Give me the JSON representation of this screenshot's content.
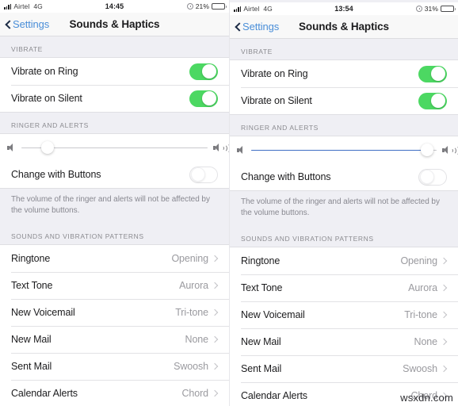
{
  "panels": [
    {
      "status": {
        "carrier": "Airtel",
        "network": "4G",
        "time": "14:45",
        "battery_percent": "21%",
        "battery_level": 0.21,
        "signal_icon": "signal-bars-icon",
        "alarm_icon": "alarm-clock-icon",
        "battery_icon": "battery-icon"
      },
      "nav": {
        "back_label": "Settings",
        "back_icon": "chevron-left-icon",
        "title": "Sounds & Haptics"
      },
      "vibrate": {
        "header": "VIBRATE",
        "rows": [
          {
            "label": "Vibrate on Ring",
            "state": "on"
          },
          {
            "label": "Vibrate on Silent",
            "state": "on"
          }
        ]
      },
      "ringer": {
        "header": "RINGER AND ALERTS",
        "slider": {
          "value": 14,
          "filled": false,
          "min_icon": "speaker-low-icon",
          "max_icon": "speaker-high-icon"
        },
        "change_with_buttons": {
          "label": "Change with Buttons",
          "state": "off"
        },
        "footer": "The volume of the ringer and alerts will not be affected by the volume buttons."
      },
      "sounds": {
        "header": "SOUNDS AND VIBRATION PATTERNS",
        "rows": [
          {
            "label": "Ringtone",
            "value": "Opening"
          },
          {
            "label": "Text Tone",
            "value": "Aurora"
          },
          {
            "label": "New Voicemail",
            "value": "Tri-tone"
          },
          {
            "label": "New Mail",
            "value": "None"
          },
          {
            "label": "Sent Mail",
            "value": "Swoosh"
          },
          {
            "label": "Calendar Alerts",
            "value": "Chord"
          }
        ]
      }
    },
    {
      "status": {
        "carrier": "Airtel",
        "network": "4G",
        "time": "13:54",
        "battery_percent": "31%",
        "battery_level": 0.31,
        "signal_icon": "signal-bars-icon",
        "alarm_icon": "alarm-clock-icon",
        "battery_icon": "battery-icon"
      },
      "nav": {
        "back_label": "Settings",
        "back_icon": "chevron-left-icon",
        "title": "Sounds & Haptics"
      },
      "vibrate": {
        "header": "VIBRATE",
        "rows": [
          {
            "label": "Vibrate on Ring",
            "state": "on"
          },
          {
            "label": "Vibrate on Silent",
            "state": "on"
          }
        ]
      },
      "ringer": {
        "header": "RINGER AND ALERTS",
        "slider": {
          "value": 95,
          "filled": true,
          "min_icon": "speaker-low-icon",
          "max_icon": "speaker-high-icon"
        },
        "change_with_buttons": {
          "label": "Change with Buttons",
          "state": "off"
        },
        "footer": "The volume of the ringer and alerts will not be affected by the volume buttons."
      },
      "sounds": {
        "header": "SOUNDS AND VIBRATION PATTERNS",
        "rows": [
          {
            "label": "Ringtone",
            "value": "Opening"
          },
          {
            "label": "Text Tone",
            "value": "Aurora"
          },
          {
            "label": "New Voicemail",
            "value": "Tri-tone"
          },
          {
            "label": "New Mail",
            "value": "None"
          },
          {
            "label": "Sent Mail",
            "value": "Swoosh"
          },
          {
            "label": "Calendar Alerts",
            "value": "Chord"
          }
        ]
      }
    }
  ],
  "watermark": "wsxdn.com",
  "colors": {
    "toggle_on": "#4cd862",
    "accent_blue": "#4a8ed8",
    "slider_fill": "#3f6fc4",
    "background": "#efeff4"
  }
}
